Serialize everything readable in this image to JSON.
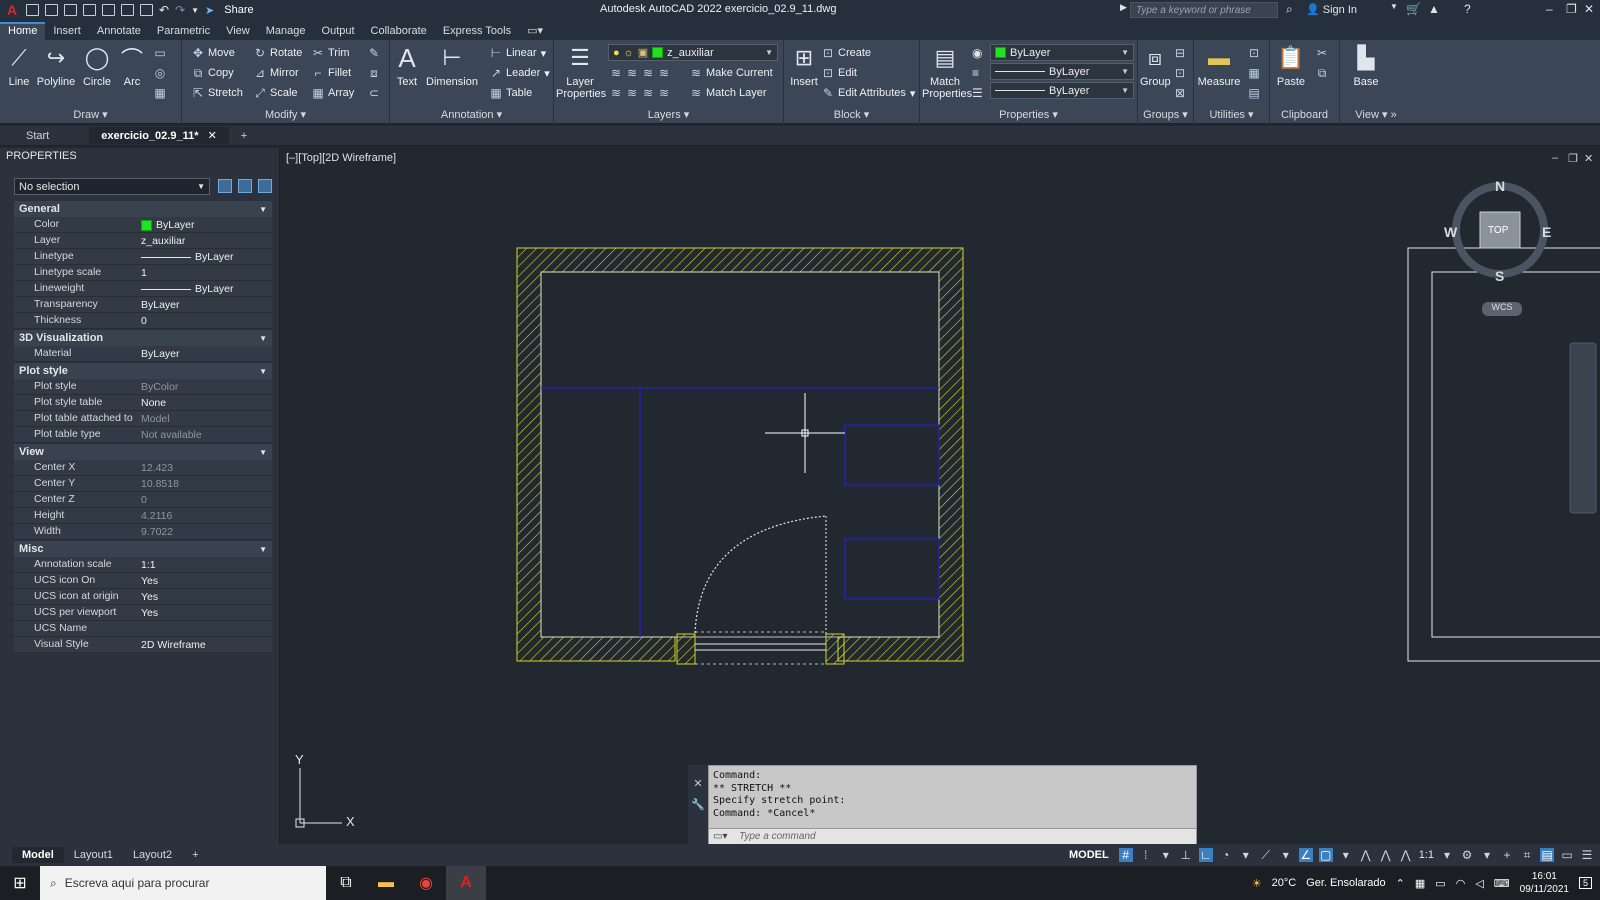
{
  "app": {
    "logo": "A",
    "share_label": "Share",
    "window_title": "Autodesk AutoCAD 2022   exercicio_02.9_11.dwg",
    "search_placeholder": "Type a keyword or phrase",
    "sign_in": "Sign In"
  },
  "ribbon_tabs": [
    "Home",
    "Insert",
    "Annotate",
    "Parametric",
    "View",
    "Manage",
    "Output",
    "Collaborate",
    "Express Tools"
  ],
  "ribbon": {
    "draw": {
      "title": "Draw",
      "line": "Line",
      "polyline": "Polyline",
      "circle": "Circle",
      "arc": "Arc"
    },
    "modify": {
      "title": "Modify",
      "move": "Move",
      "rotate": "Rotate",
      "trim": "Trim",
      "copy": "Copy",
      "mirror": "Mirror",
      "fillet": "Fillet",
      "stretch": "Stretch",
      "scale": "Scale",
      "array": "Array"
    },
    "annotation": {
      "title": "Annotation",
      "text": "Text",
      "dimension": "Dimension",
      "linear": "Linear",
      "leader": "Leader",
      "table": "Table"
    },
    "layers": {
      "title": "Layers",
      "layer_properties": "Layer Properties",
      "current_layer": "z_auxiliar",
      "make_current": "Make Current",
      "match_layer": "Match Layer"
    },
    "block": {
      "title": "Block",
      "insert": "Insert",
      "create": "Create",
      "edit": "Edit",
      "edit_attributes": "Edit Attributes"
    },
    "properties": {
      "title": "Properties",
      "match_properties": "Match Properties",
      "color": "ByLayer",
      "linetype": "ByLayer",
      "lineweight": "ByLayer"
    },
    "groups": {
      "title": "Groups",
      "group": "Group"
    },
    "utilities": {
      "title": "Utilities",
      "measure": "Measure"
    },
    "clipboard": {
      "title": "Clipboard",
      "paste": "Paste"
    },
    "view": {
      "title": "View",
      "base": "Base"
    }
  },
  "doc_tabs": {
    "start": "Start",
    "active": "exercicio_02.9_11*"
  },
  "properties_palette": {
    "title": "PROPERTIES",
    "selection": "No selection",
    "categories": [
      {
        "name": "General",
        "rows": [
          {
            "k": "Color",
            "v": "ByLayer",
            "swatch": "#22e022"
          },
          {
            "k": "Layer",
            "v": "z_auxiliar"
          },
          {
            "k": "Linetype",
            "v": "ByLayer",
            "line": true
          },
          {
            "k": "Linetype scale",
            "v": "1"
          },
          {
            "k": "Lineweight",
            "v": "ByLayer",
            "line": true
          },
          {
            "k": "Transparency",
            "v": "ByLayer"
          },
          {
            "k": "Thickness",
            "v": "0"
          }
        ]
      },
      {
        "name": "3D Visualization",
        "rows": [
          {
            "k": "Material",
            "v": "ByLayer"
          }
        ]
      },
      {
        "name": "Plot style",
        "rows": [
          {
            "k": "Plot style",
            "v": "ByColor",
            "dim": true
          },
          {
            "k": "Plot style table",
            "v": "None"
          },
          {
            "k": "Plot table attached to",
            "v": "Model",
            "dim": true
          },
          {
            "k": "Plot table type",
            "v": "Not available",
            "dim": true
          }
        ]
      },
      {
        "name": "View",
        "rows": [
          {
            "k": "Center X",
            "v": "12.423",
            "dim": true
          },
          {
            "k": "Center Y",
            "v": "10.8518",
            "dim": true
          },
          {
            "k": "Center Z",
            "v": "0",
            "dim": true
          },
          {
            "k": "Height",
            "v": "4.2116",
            "dim": true
          },
          {
            "k": "Width",
            "v": "9.7022",
            "dim": true
          }
        ]
      },
      {
        "name": "Misc",
        "rows": [
          {
            "k": "Annotation scale",
            "v": "1:1"
          },
          {
            "k": "UCS icon On",
            "v": "Yes"
          },
          {
            "k": "UCS icon at origin",
            "v": "Yes"
          },
          {
            "k": "UCS per viewport",
            "v": "Yes"
          },
          {
            "k": "UCS Name",
            "v": ""
          },
          {
            "k": "Visual Style",
            "v": "2D Wireframe"
          }
        ]
      }
    ]
  },
  "viewport": {
    "label": "[–][Top][2D Wireframe]",
    "compass": {
      "n": "N",
      "s": "S",
      "e": "E",
      "w": "W",
      "top": "TOP",
      "wcs": "WCS"
    },
    "ucs": {
      "x": "X",
      "y": "Y"
    }
  },
  "command_line": {
    "history": [
      "Command:",
      "** STRETCH **",
      "Specify stretch point:",
      "Command: *Cancel*"
    ],
    "placeholder": "Type a command"
  },
  "layout_tabs": [
    "Model",
    "Layout1",
    "Layout2"
  ],
  "status": {
    "model": "MODEL",
    "scale": "1:1"
  },
  "taskbar": {
    "search_placeholder": "Escreva aqui para procurar",
    "weather_temp": "20°C",
    "weather_desc": "Ger. Ensolarado",
    "time": "16:01",
    "date": "09/11/2021",
    "notifications": "5"
  },
  "colors": {
    "wall_hatch": "#d4d42a",
    "blue_lines": "#2222c8",
    "ui_bg": "#212830",
    "ribbon": "#3b4656"
  }
}
